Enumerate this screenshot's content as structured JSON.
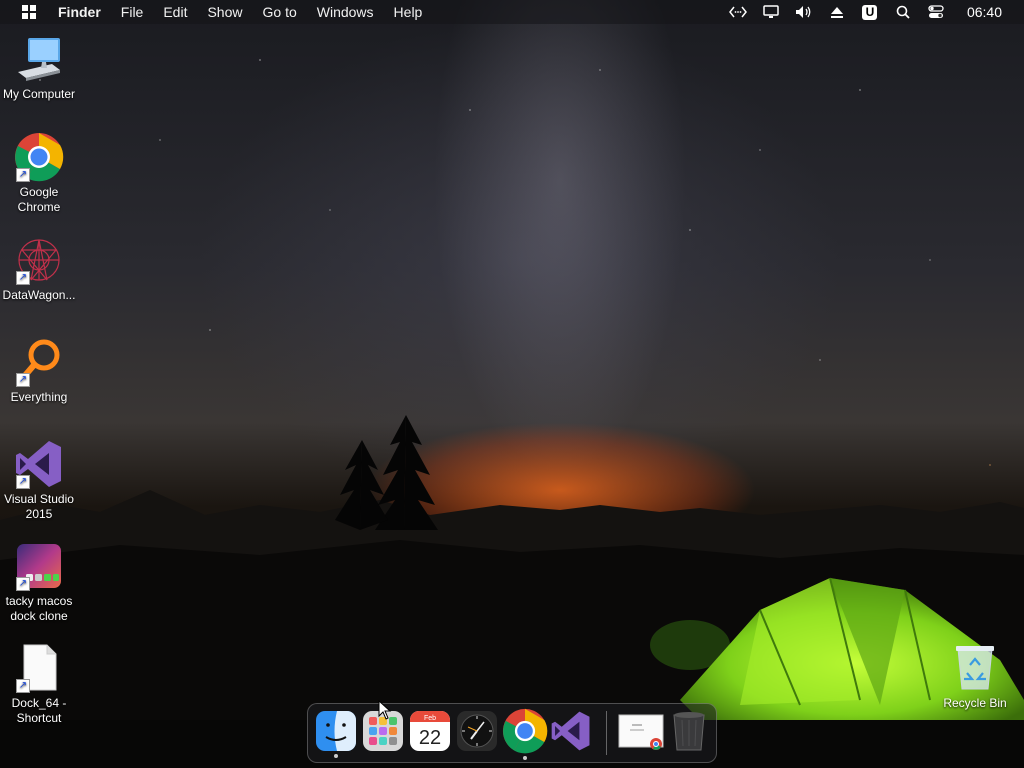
{
  "menubar": {
    "app_name": "Finder",
    "items": [
      "File",
      "Edit",
      "Show",
      "Go to",
      "Windows",
      "Help"
    ],
    "status_icons": [
      "code-icon",
      "display-icon",
      "volume-icon",
      "eject-icon",
      "u-icon",
      "search-icon",
      "control-center-icon"
    ],
    "u_label": "U",
    "clock": "06:40"
  },
  "desktop_icons": [
    {
      "label": "My Computer",
      "icon": "computer-icon"
    },
    {
      "label": "Google Chrome",
      "icon": "chrome-icon"
    },
    {
      "label": "DataWagon...",
      "icon": "datawagon-icon"
    },
    {
      "label": "Everything",
      "icon": "everything-icon"
    },
    {
      "label": "Visual Studio 2015",
      "icon": "visual-studio-icon"
    },
    {
      "label": "tacky macos dock clone",
      "icon": "dock-clone-icon"
    },
    {
      "label": "Dock_64 - Shortcut",
      "icon": "document-icon"
    },
    {
      "label": "Recycle Bin",
      "icon": "recycle-bin-icon"
    }
  ],
  "dock": {
    "items": [
      {
        "name": "finder",
        "running": true
      },
      {
        "name": "launchpad",
        "running": false
      },
      {
        "name": "calendar",
        "running": false,
        "month": "Feb",
        "day": "22"
      },
      {
        "name": "clock",
        "running": false
      },
      {
        "name": "chrome",
        "running": true
      },
      {
        "name": "visual-studio",
        "running": false
      },
      {
        "name": "chrome-window-preview",
        "running": false
      },
      {
        "name": "trash",
        "running": false
      }
    ]
  }
}
